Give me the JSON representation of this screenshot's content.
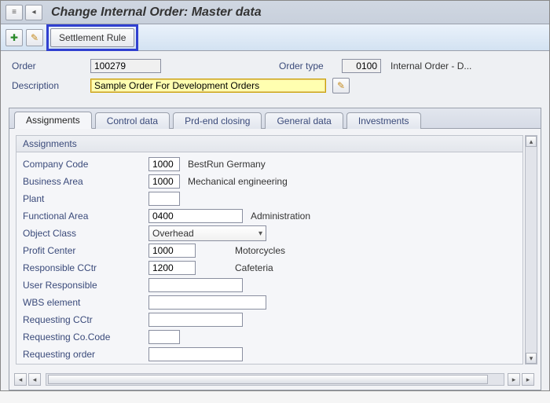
{
  "title": "Change Internal Order: Master data",
  "toolbar": {
    "settlement_rule_label": "Settlement Rule"
  },
  "header": {
    "order_label": "Order",
    "order_value": "100279",
    "order_type_label": "Order type",
    "order_type_value": "0100",
    "order_type_text": "Internal Order - D...",
    "description_label": "Description",
    "description_value": "Sample Order For Development Orders"
  },
  "tabs": [
    {
      "id": "assignments",
      "label": "Assignments",
      "active": true
    },
    {
      "id": "controldata",
      "label": "Control data",
      "active": false
    },
    {
      "id": "prdend",
      "label": "Prd-end closing",
      "active": false
    },
    {
      "id": "generaldata",
      "label": "General data",
      "active": false
    },
    {
      "id": "investments",
      "label": "Investments",
      "active": false
    }
  ],
  "assignments": {
    "panel_title": "Assignments",
    "fields": {
      "company_code": {
        "label": "Company Code",
        "value": "1000",
        "text": "BestRun Germany"
      },
      "business_area": {
        "label": "Business Area",
        "value": "1000",
        "text": "Mechanical engineering"
      },
      "plant": {
        "label": "Plant",
        "value": "",
        "text": ""
      },
      "functional_area": {
        "label": "Functional Area",
        "value": "0400",
        "text": "Administration"
      },
      "object_class": {
        "label": "Object Class",
        "value": "Overhead",
        "text": ""
      },
      "profit_center": {
        "label": "Profit Center",
        "value": "1000",
        "text": "Motorcycles"
      },
      "responsible_cctr": {
        "label": "Responsible CCtr",
        "value": "1200",
        "text": "Cafeteria"
      },
      "user_responsible": {
        "label": "User Responsible",
        "value": "",
        "text": ""
      },
      "wbs_element": {
        "label": "WBS element",
        "value": "",
        "text": ""
      },
      "requesting_cctr": {
        "label": "Requesting CCtr",
        "value": "",
        "text": ""
      },
      "requesting_cocode": {
        "label": "Requesting Co.Code",
        "value": "",
        "text": ""
      },
      "requesting_order": {
        "label": "Requesting order",
        "value": "",
        "text": ""
      }
    }
  },
  "icons": {
    "menu": "≡",
    "back": "◂",
    "new": "✚",
    "edit": "✎",
    "dropdown": "▾",
    "up": "▴",
    "down": "▾",
    "left": "◂",
    "right": "▸"
  }
}
